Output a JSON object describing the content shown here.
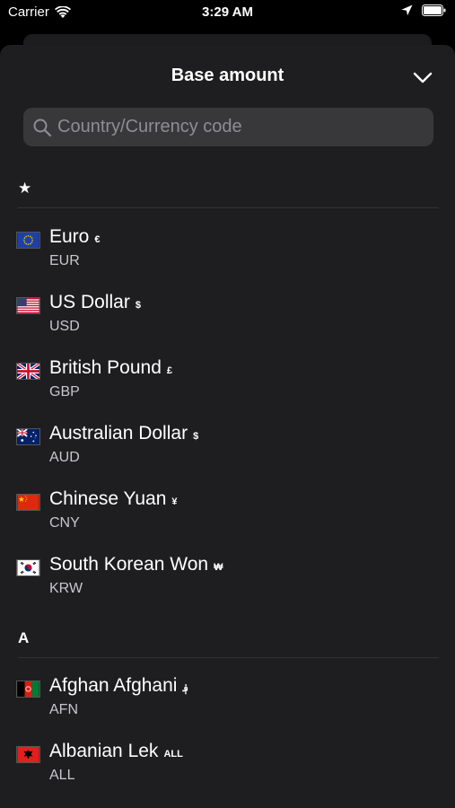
{
  "status_bar": {
    "carrier": "Carrier",
    "time": "3:29 AM"
  },
  "sheet": {
    "title": "Base amount",
    "search_placeholder": "Country/Currency code"
  },
  "sections": [
    {
      "header": "★",
      "currencies": [
        {
          "name": "Euro",
          "symbol": "€",
          "code": "EUR",
          "flag": "eu-flag-icon"
        },
        {
          "name": "US Dollar",
          "symbol": "$",
          "code": "USD",
          "flag": "us-flag-icon"
        },
        {
          "name": "British Pound",
          "symbol": "£",
          "code": "GBP",
          "flag": "gb-flag-icon"
        },
        {
          "name": "Australian Dollar",
          "symbol": "$",
          "code": "AUD",
          "flag": "au-flag-icon"
        },
        {
          "name": "Chinese Yuan",
          "symbol": "¥",
          "code": "CNY",
          "flag": "cn-flag-icon"
        },
        {
          "name": "South Korean Won",
          "symbol": "₩",
          "code": "KRW",
          "flag": "kr-flag-icon"
        }
      ]
    },
    {
      "header": "A",
      "currencies": [
        {
          "name": "Afghan Afghani",
          "symbol": "؋",
          "code": "AFN",
          "flag": "af-flag-icon"
        },
        {
          "name": "Albanian Lek",
          "symbol": "ALL",
          "code": "ALL",
          "flag": "al-flag-icon"
        }
      ]
    }
  ]
}
